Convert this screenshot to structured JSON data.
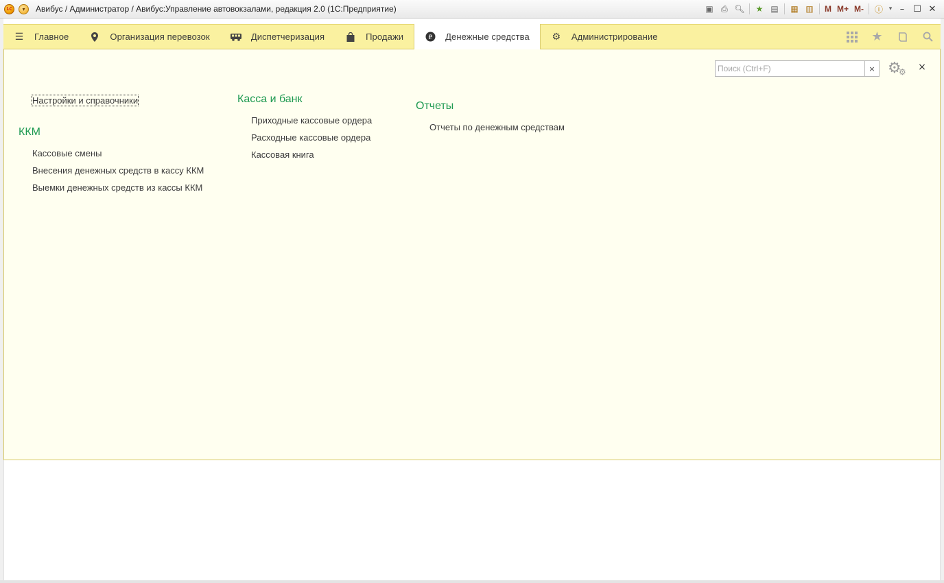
{
  "window": {
    "title": "Авибус / Администратор / Авибус:Управление автовокзалами, редакция 2.0  (1С:Предприятие)",
    "logo_text": "1С",
    "tools": {
      "m": "M",
      "m_plus": "M+",
      "m_minus": "M-"
    }
  },
  "sections": [
    {
      "label": "Главное",
      "icon": "menu-icon"
    },
    {
      "label": "Организация перевозок",
      "icon": "map-pin-icon"
    },
    {
      "label": "Диспетчеризация",
      "icon": "bus-icon"
    },
    {
      "label": "Продажи",
      "icon": "shopping-bag-icon"
    },
    {
      "label": "Денежные средства",
      "icon": "ruble-icon",
      "active": true
    },
    {
      "label": "Администрирование",
      "icon": "gear-icon"
    }
  ],
  "search": {
    "placeholder": "Поиск (Ctrl+F)",
    "clear": "×"
  },
  "close": "×",
  "content": {
    "settings_link": "Настройки и справочники",
    "groups": [
      {
        "title": "ККМ",
        "items": [
          "Кассовые смены",
          "Внесения денежных средств в кассу ККМ",
          "Выемки денежных средств из кассы ККМ"
        ]
      },
      {
        "title": "Касса и банк",
        "items": [
          "Приходные кассовые ордера",
          "Расходные кассовые ордера",
          "Кассовая книга"
        ]
      },
      {
        "title": "Отчеты",
        "items": [
          "Отчеты по денежным средствам"
        ]
      }
    ]
  },
  "colors": {
    "sections_bg": "#faf1a0",
    "content_bg": "#fffff0",
    "group_title": "#1f9a52"
  }
}
